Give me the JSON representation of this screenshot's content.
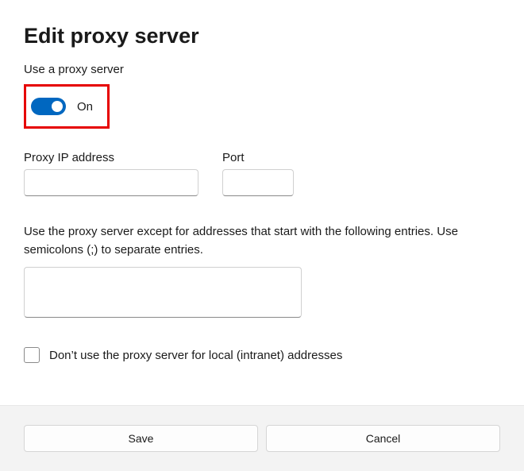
{
  "title": "Edit proxy server",
  "use_proxy_label": "Use a proxy server",
  "toggle": {
    "state_label": "On",
    "on": true
  },
  "ip": {
    "label": "Proxy IP address",
    "value": ""
  },
  "port": {
    "label": "Port",
    "value": ""
  },
  "exceptions": {
    "label": "Use the proxy server except for addresses that start with the following entries. Use semicolons (;) to separate entries.",
    "value": ""
  },
  "local_bypass": {
    "label": "Don’t use the proxy server for local (intranet) addresses",
    "checked": false
  },
  "buttons": {
    "save": "Save",
    "cancel": "Cancel"
  }
}
